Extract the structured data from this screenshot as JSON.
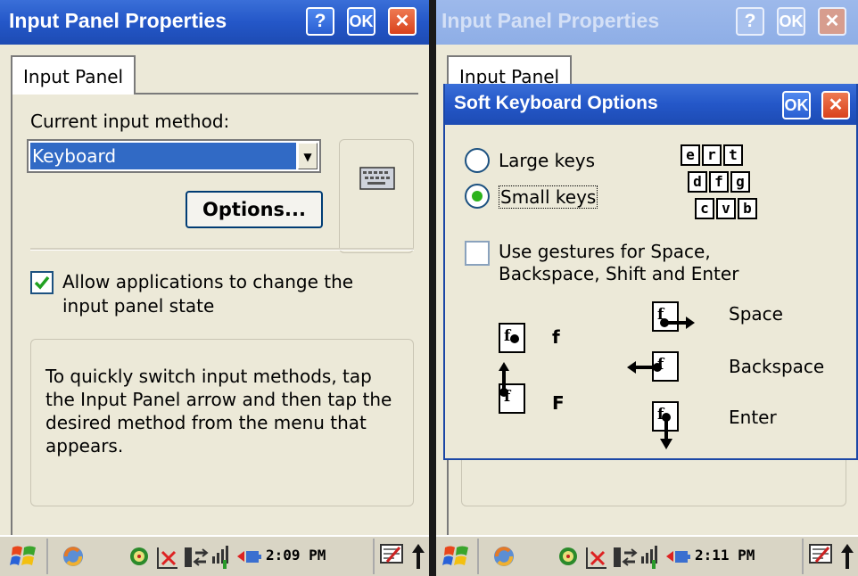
{
  "left": {
    "title": "Input Panel Properties",
    "help_button": "?",
    "ok_button": "OK",
    "close_button": "✕",
    "tab": "Input Panel",
    "current_method_label": "Current input method:",
    "selected_method": "Keyboard",
    "options_button": "Options...",
    "allow_checkbox": {
      "checked": true,
      "line1": "Allow applications to change the",
      "line2": "input panel state"
    },
    "info_text": "To quickly switch input methods, tap the Input Panel arrow and then tap the desired method from the menu that appears.",
    "taskbar": {
      "time": "2:09 PM"
    }
  },
  "right": {
    "title": "Input Panel Properties",
    "help_button": "?",
    "ok_button": "OK",
    "close_button": "✕",
    "tab": "Input Panel",
    "dialog": {
      "title": "Soft Keyboard Options",
      "ok_button": "OK",
      "close_button": "✕",
      "large_keys": "Large keys",
      "small_keys": "Small keys",
      "selected": "Small keys",
      "keys_row1": [
        "e",
        "r",
        "t"
      ],
      "keys_row2": [
        "d",
        "f",
        "g"
      ],
      "keys_row3": [
        "c",
        "v",
        "b"
      ],
      "gestures_line1": "Use gestures for Space,",
      "gestures_line2": "Backspace, Shift and Enter",
      "gestures_checked": false,
      "gesture_f": "f",
      "gesture_F": "F",
      "gesture_space": "Space",
      "gesture_backspace": "Backspace",
      "gesture_enter": "Enter",
      "glyph_f": "f"
    },
    "taskbar": {
      "time": "2:11 PM"
    }
  },
  "colors": {
    "titlebar": "#2457c8",
    "selection": "#316ac5",
    "check": "#2cb31c",
    "close": "#d9421c"
  },
  "icons": [
    "windows-start-icon",
    "sync-icon",
    "network-icon",
    "connection-off-icon",
    "battery-icon",
    "signal-icon",
    "input-panel-icon",
    "keyboard-icon"
  ]
}
